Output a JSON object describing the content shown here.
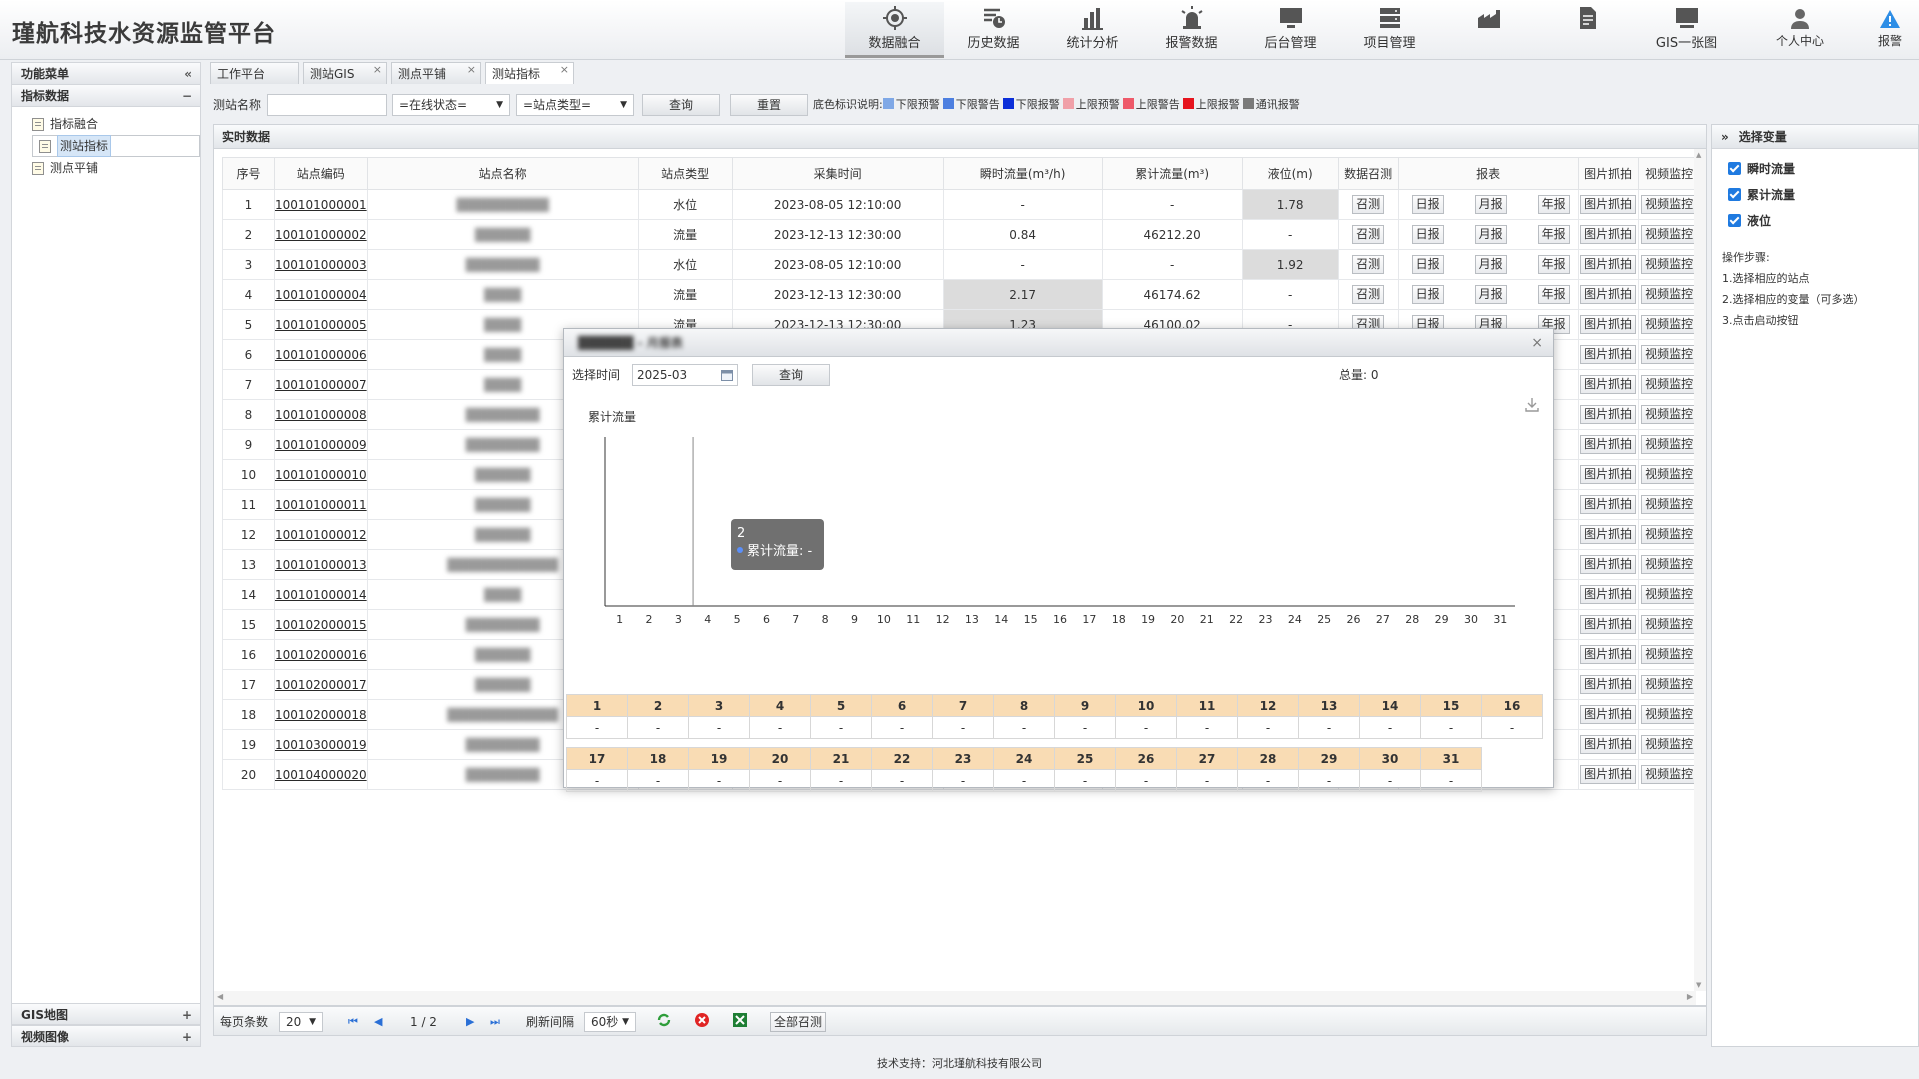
{
  "app": {
    "title": "瑾航科技水资源监管平台"
  },
  "nav": [
    {
      "label": "数据融合",
      "icon": "crosshair-icon",
      "active": true
    },
    {
      "label": "历史数据",
      "icon": "history-list-icon"
    },
    {
      "label": "统计分析",
      "icon": "bar-chart-icon"
    },
    {
      "label": "报警数据",
      "icon": "alarm-light-icon"
    },
    {
      "label": "后台管理",
      "icon": "monitor-icon"
    },
    {
      "label": "项目管理",
      "icon": "server-icon"
    },
    {
      "label": "",
      "icon": "factory-icon",
      "blur": true
    },
    {
      "label": "",
      "icon": "report-file-icon",
      "blur": true
    },
    {
      "label": "GIS一张图",
      "icon": "screen-icon"
    }
  ],
  "header_right": {
    "user_label": "个人中心",
    "alarm_label": "报警"
  },
  "sidebar": {
    "title": "功能菜单",
    "collapse": "«",
    "section": "指标数据",
    "section_ctl": "−",
    "items": [
      "指标融合",
      "测站指标",
      "测点平铺"
    ],
    "selected": 1,
    "gis": "GIS地图",
    "video": "视频图像",
    "plus": "+"
  },
  "tabs": [
    {
      "label": "工作平台",
      "close": ""
    },
    {
      "label": "测站GIS",
      "close": "×"
    },
    {
      "label": "测点平铺",
      "close": "×"
    },
    {
      "label": "测站指标",
      "close": "×",
      "active": true
    }
  ],
  "toolbar": {
    "name_label": "测站名称",
    "name_value": "",
    "status_select": "=在线状态=",
    "type_select": "=站点类型=",
    "query": "查询",
    "reset": "重置",
    "legend_title": "底色标识说明:",
    "legend": [
      {
        "label": "下限预警",
        "color": "#7fa8e6"
      },
      {
        "label": "下限警告",
        "color": "#4d7fe0"
      },
      {
        "label": "下限报警",
        "color": "#0b2fd9"
      },
      {
        "label": "上限预警",
        "color": "#f0a0a8"
      },
      {
        "label": "上限警告",
        "color": "#ee5a6a"
      },
      {
        "label": "上限报警",
        "color": "#e6141e"
      },
      {
        "label": "通讯报警",
        "color": "#7a7a7a"
      }
    ]
  },
  "main": {
    "title": "实时数据",
    "columns": [
      "序号",
      "站点编码",
      "站点名称",
      "站点类型",
      "采集时间",
      "瞬时流量(m³/h)",
      "累计流量(m³)",
      "液位(m)",
      "数据召测",
      "报表",
      "图片抓拍",
      "视频监控"
    ],
    "btn": {
      "call": "召测",
      "daily": "日报",
      "monthly": "月报",
      "yearly": "年报",
      "snap": "图片抓拍",
      "video": "视频监控"
    },
    "rows": [
      {
        "no": "1",
        "code": "100101000001",
        "name": "██████████",
        "type": "水位",
        "time": "2023-08-05 12:10:00",
        "flow": "-",
        "total": "-",
        "level": "1.78",
        "hl": "level"
      },
      {
        "no": "2",
        "code": "100101000002",
        "name": "██████",
        "type": "流量",
        "time": "2023-12-13 12:30:00",
        "flow": "0.84",
        "total": "46212.20",
        "level": "-"
      },
      {
        "no": "3",
        "code": "100101000003",
        "name": "████████",
        "type": "水位",
        "time": "2023-08-05 12:10:00",
        "flow": "-",
        "total": "-",
        "level": "1.92",
        "hl": "level"
      },
      {
        "no": "4",
        "code": "100101000004",
        "name": "████",
        "type": "流量",
        "time": "2023-12-13 12:30:00",
        "flow": "2.17",
        "total": "46174.62",
        "level": "-",
        "hl": "flow"
      },
      {
        "no": "5",
        "code": "100101000005",
        "name": "████",
        "type": "流量",
        "time": "2023-12-13 12:30:00",
        "flow": "1.23",
        "total": "46100.02",
        "level": "-",
        "hl": "flow"
      },
      {
        "no": "6",
        "code": "100101000006",
        "name": "████"
      },
      {
        "no": "7",
        "code": "100101000007",
        "name": "████"
      },
      {
        "no": "8",
        "code": "100101000008",
        "name": "████████"
      },
      {
        "no": "9",
        "code": "100101000009",
        "name": "████████"
      },
      {
        "no": "10",
        "code": "100101000010",
        "name": "██████"
      },
      {
        "no": "11",
        "code": "100101000011",
        "name": "██████"
      },
      {
        "no": "12",
        "code": "100101000012",
        "name": "██████"
      },
      {
        "no": "13",
        "code": "100101000013",
        "name": "████████████"
      },
      {
        "no": "14",
        "code": "100101000014",
        "name": "████"
      },
      {
        "no": "15",
        "code": "100102000015",
        "name": "████████"
      },
      {
        "no": "16",
        "code": "100102000016",
        "name": "██████"
      },
      {
        "no": "17",
        "code": "100102000017",
        "name": "██████"
      },
      {
        "no": "18",
        "code": "100102000018",
        "name": "████████████"
      },
      {
        "no": "19",
        "code": "100103000019",
        "name": "████████"
      },
      {
        "no": "20",
        "code": "100104000020",
        "name": "████████"
      }
    ]
  },
  "pager": {
    "size_label": "每页条数",
    "size": "20",
    "page": "1 / 2",
    "refresh_label": "刷新间隔",
    "refresh": "60秒",
    "call_all": "全部召测"
  },
  "right": {
    "title": "选择变量",
    "expand": "»",
    "vars": [
      "瞬时流量",
      "累计流量",
      "液位"
    ],
    "steps_title": "操作步骤:",
    "steps": [
      "1.选择相应的站点",
      "2.选择相应的变量（可多选）",
      "3.点击启动按钮"
    ]
  },
  "dialog": {
    "title": "██████ - 月报表",
    "close": "×",
    "time_label": "选择时间",
    "time_value": "2025-03",
    "query": "查询",
    "total_label": "总量:",
    "total_value": "0",
    "chart_data": {
      "type": "line",
      "ylabel": "累计流量",
      "x": [
        1,
        2,
        3,
        4,
        5,
        6,
        7,
        8,
        9,
        10,
        11,
        12,
        13,
        14,
        15,
        16,
        17,
        18,
        19,
        20,
        21,
        22,
        23,
        24,
        25,
        26,
        27,
        28,
        29,
        30,
        31
      ],
      "series": [
        {
          "name": "累计流量",
          "values": []
        }
      ],
      "tooltip": {
        "x": "2",
        "label": "累计流量:",
        "value": "-"
      }
    },
    "calendar_row1": [
      "1",
      "2",
      "3",
      "4",
      "5",
      "6",
      "7",
      "8",
      "9",
      "10",
      "11",
      "12",
      "13",
      "14",
      "15",
      "16"
    ],
    "calendar_row2": [
      "17",
      "18",
      "19",
      "20",
      "21",
      "22",
      "23",
      "24",
      "25",
      "26",
      "27",
      "28",
      "29",
      "30",
      "31"
    ],
    "empty_value": "-"
  },
  "footer": "技术支持：河北瑾航科技有限公司"
}
